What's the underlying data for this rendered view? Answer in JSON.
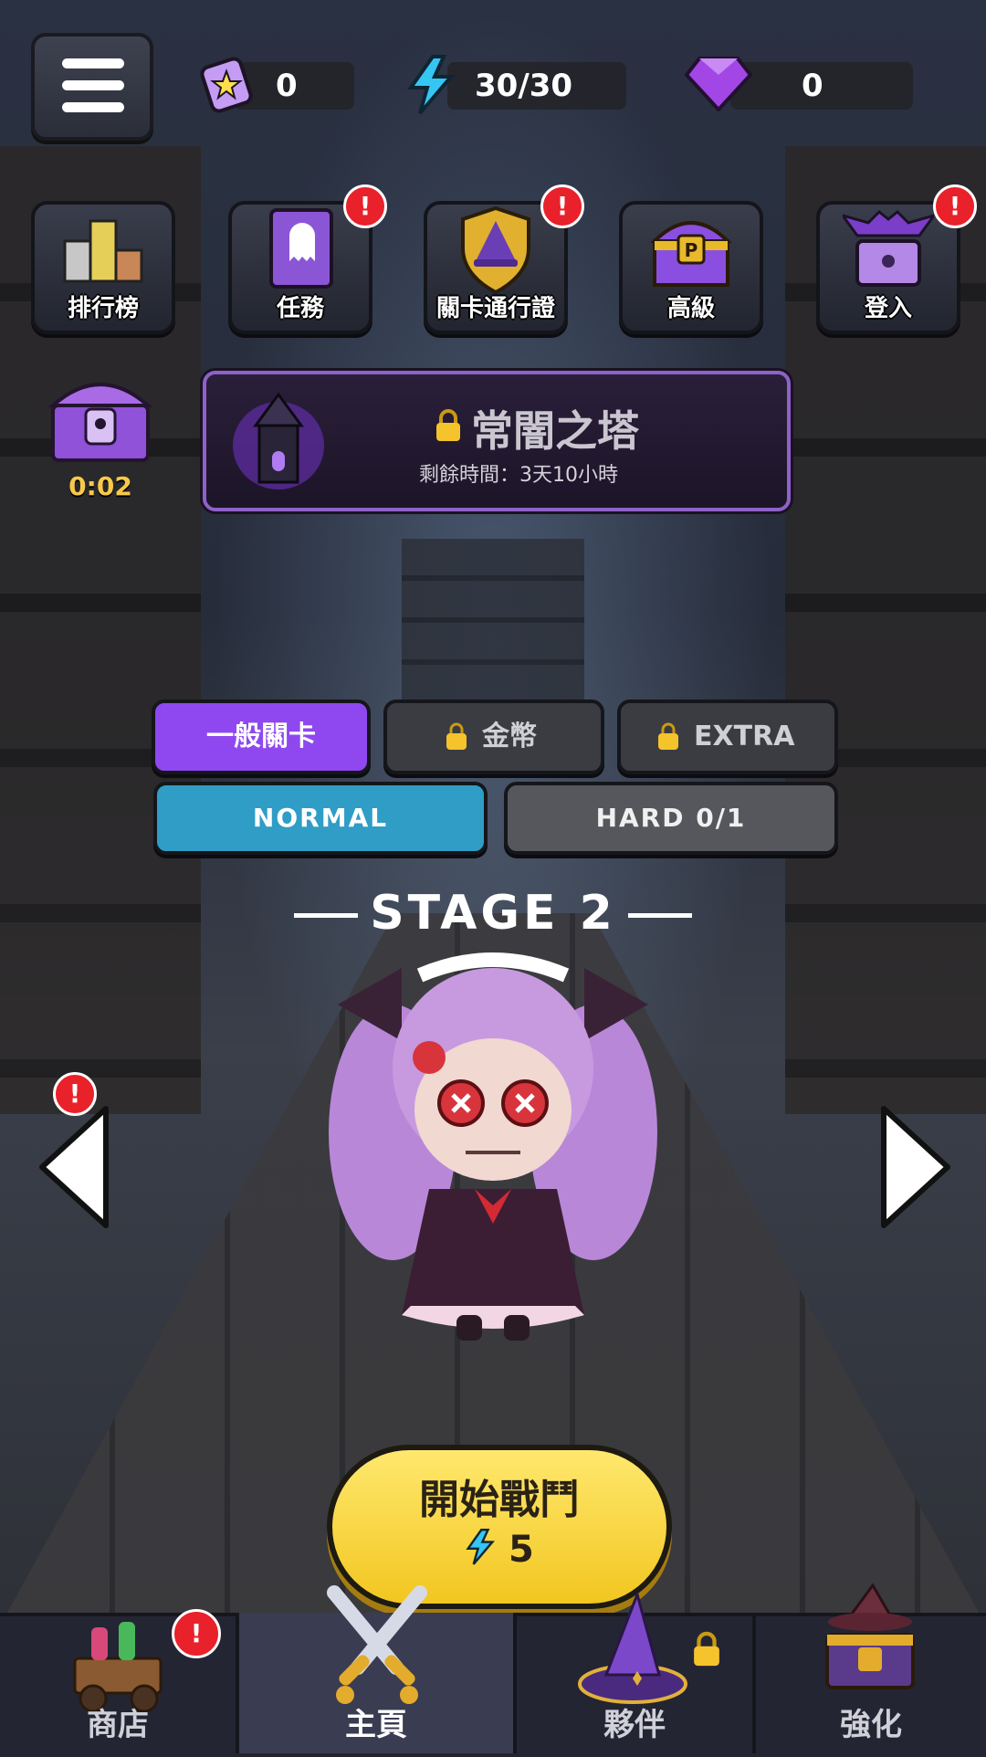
{
  "top_bar": {
    "ticket_count": "0",
    "energy": "30/30",
    "gem_count": "0"
  },
  "features": [
    {
      "label": "排行榜",
      "alert": false
    },
    {
      "label": "任務",
      "alert": true
    },
    {
      "label": "關卡通行證",
      "alert": true
    },
    {
      "label": "高級",
      "alert": false
    },
    {
      "label": "登入",
      "alert": true
    }
  ],
  "alert_mark": "!",
  "chest_timer": "0:02",
  "event": {
    "title": "常闇之塔",
    "remaining": "剩餘時間：3天10小時"
  },
  "mode_tabs": [
    {
      "label": "一般關卡",
      "locked": false
    },
    {
      "label": "金幣",
      "locked": true
    },
    {
      "label": "EXTRA",
      "locked": true
    }
  ],
  "difficulty": {
    "normal": "NORMAL",
    "hard": "HARD 0/1"
  },
  "stage": "STAGE 2",
  "start_button": {
    "label": "開始戰鬥",
    "cost": "5"
  },
  "nav": [
    {
      "label": "商店",
      "alert": true,
      "locked": false
    },
    {
      "label": "主頁",
      "alert": false,
      "locked": false
    },
    {
      "label": "夥伴",
      "alert": false,
      "locked": true
    },
    {
      "label": "強化",
      "alert": false,
      "locked": false
    }
  ],
  "colors": {
    "accent_purple": "#8f48ef",
    "normal_blue": "#2f9dc6",
    "start_yellow": "#f2c620",
    "alert_red": "#e8212b"
  }
}
